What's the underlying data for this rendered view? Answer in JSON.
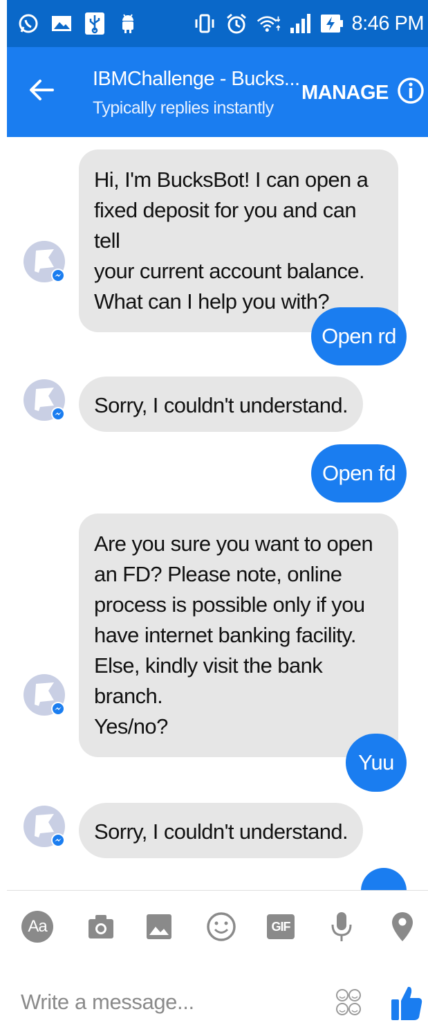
{
  "status_bar": {
    "time": "8:46 PM",
    "icons": [
      "whatsapp-icon",
      "gallery-icon",
      "usb-icon",
      "android-icon",
      "vibrate-icon",
      "alarm-icon",
      "wifi-icon",
      "signal-icon",
      "battery-charging-icon"
    ]
  },
  "header": {
    "title": "IBMChallenge - Bucks...",
    "subtitle": "Typically replies instantly",
    "manage_label": "MANAGE",
    "back_icon": "arrow-left-icon",
    "info_icon": "info-icon"
  },
  "messages": [
    {
      "from": "bot",
      "text": "Hi, I'm BucksBot! I can open a fixed deposit for you and can tell your current account balance. What can I help you with?"
    },
    {
      "from": "user",
      "text": "Open rd"
    },
    {
      "from": "bot",
      "text": "Sorry, I couldn't understand."
    },
    {
      "from": "user",
      "text": "Open fd"
    },
    {
      "from": "bot",
      "text": "Are you sure you want to open an FD? Please note, online process is possible only if you have internet banking facility. Else, kindly visit the bank branch. Yes/no?"
    },
    {
      "from": "user",
      "text": "Yuu"
    },
    {
      "from": "bot",
      "text": "Sorry, I couldn't understand."
    }
  ],
  "bot_bubble_lines": {
    "m0": [
      "Hi, I'm BucksBot! I can open a",
      "fixed deposit for you and can tell",
      "your current account balance.",
      "What can I help you with?"
    ],
    "m4": [
      "Are you sure you want to open",
      "an FD? Please note, online",
      "process is possible only if you",
      "have internet banking facility.",
      "Else, kindly visit the bank branch.",
      "Yes/no?"
    ]
  },
  "toolbar": {
    "text_label": "Aa",
    "gif_label": "GIF",
    "icons": [
      "text-format-icon",
      "camera-icon",
      "image-icon",
      "emoji-icon",
      "gif-icon",
      "microphone-icon",
      "location-icon"
    ]
  },
  "composer": {
    "placeholder": "Write a message...",
    "sticker_icon": "sticker-icon",
    "like_icon": "thumbs-up-icon"
  },
  "colors": {
    "status_bar": "#0a68c9",
    "header": "#1a7df0",
    "bubble_user": "#1a7df0",
    "bubble_bot": "#e6e6e6",
    "icon_gray": "#8a8a8a"
  }
}
